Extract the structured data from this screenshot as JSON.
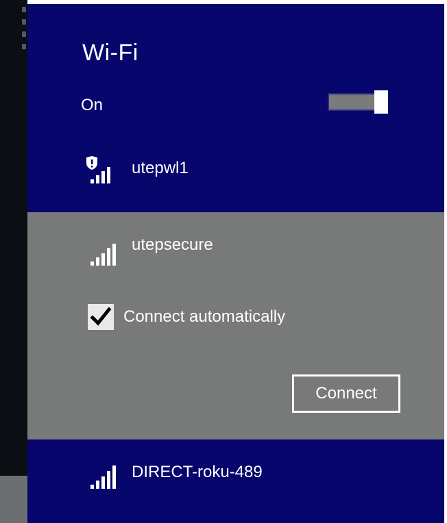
{
  "flyout": {
    "title": "Wi-Fi",
    "toggle_label": "On",
    "toggle_state": "on"
  },
  "networks": [
    {
      "name": "utepwl1",
      "secured_badge": true,
      "icon": "wifi-signal-secured-icon"
    },
    {
      "name": "utepsecure",
      "secured_badge": false,
      "icon": "wifi-signal-icon",
      "selected": true
    },
    {
      "name": "DIRECT-roku-489",
      "secured_badge": false,
      "icon": "wifi-signal-icon"
    }
  ],
  "selected_network": {
    "connect_automatically_label": "Connect automatically",
    "connect_automatically_checked": true,
    "connect_button_label": "Connect"
  },
  "colors": {
    "panel_bg": "#06066c",
    "selected_bg": "#777a79",
    "text": "#ffffff"
  }
}
